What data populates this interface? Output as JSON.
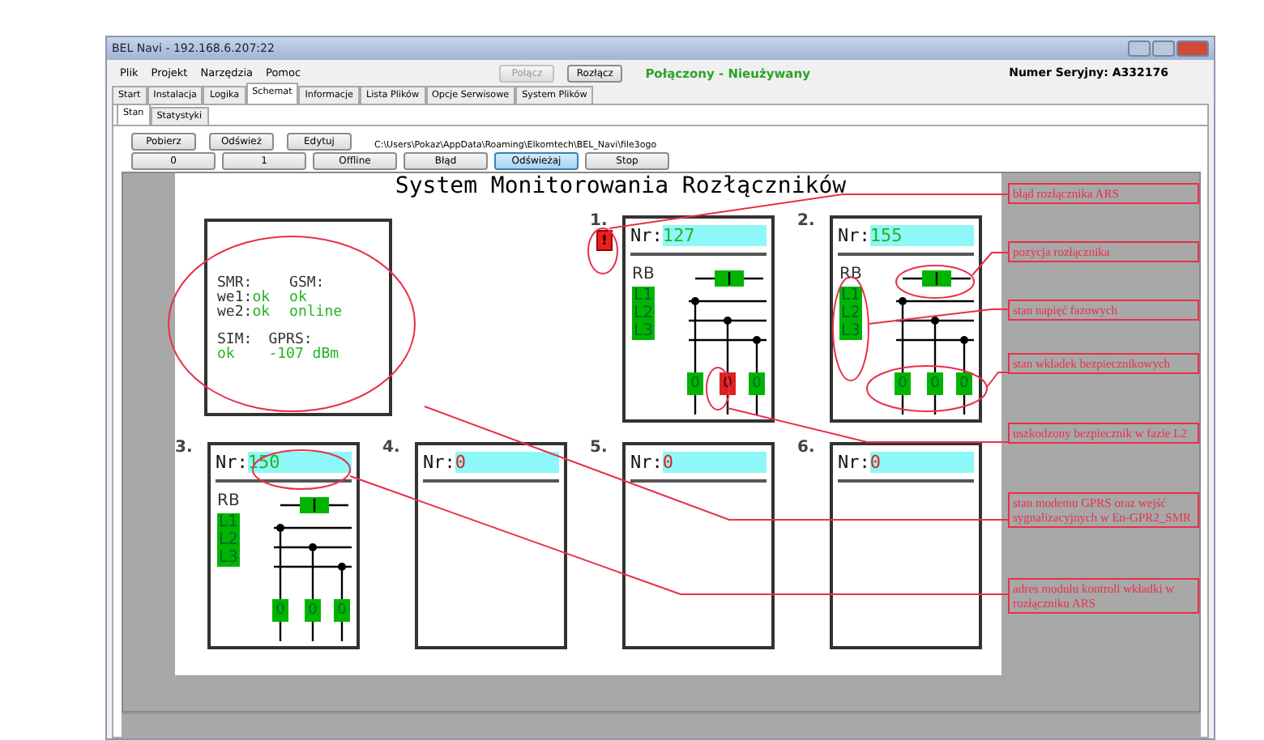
{
  "window": {
    "title": "BEL Navi - 192.168.6.207:22"
  },
  "menu": [
    "Plik",
    "Projekt",
    "Narzędzia",
    "Pomoc"
  ],
  "connection": {
    "connect_label": "Połącz",
    "connect_disabled": true,
    "disconnect_label": "Rozłącz",
    "status": "Połączony - Nieużywany",
    "serial": "Numer Seryjny: A332176"
  },
  "tabs": [
    {
      "label": "Start",
      "selected": false
    },
    {
      "label": "Instalacja",
      "selected": false
    },
    {
      "label": "Logika",
      "selected": false
    },
    {
      "label": "Schemat",
      "selected": true
    },
    {
      "label": "Informacje",
      "selected": false
    },
    {
      "label": "Lista Plików",
      "selected": false
    },
    {
      "label": "Opcje Serwisowe",
      "selected": false
    },
    {
      "label": "System Plików",
      "selected": false
    }
  ],
  "subtabs": [
    {
      "label": "Stan",
      "selected": true
    },
    {
      "label": "Statystyki",
      "selected": false
    }
  ],
  "toolbar": {
    "buttons": [
      "Pobierz",
      "Odśwież",
      "Edytuj"
    ],
    "path": "C:\\Users\\Pokaz\\AppData\\Roaming\\Elkomtech\\BEL_Navi\\file3ogo"
  },
  "mode_buttons": [
    {
      "label": "0",
      "selected": false
    },
    {
      "label": "1",
      "selected": false
    },
    {
      "label": "Offline",
      "selected": false
    },
    {
      "label": "Błąd",
      "selected": false
    },
    {
      "label": "Odświeżaj",
      "selected": true
    },
    {
      "label": "Stop",
      "selected": false
    }
  ],
  "canvas": {
    "title": "System Monitorowania Rozłączników",
    "status_panel": {
      "smr_label": "SMR:",
      "we1_label": "we1:",
      "we1_value": "ok",
      "we2_label": "we2:",
      "we2_value": "ok",
      "gsm_label": "GSM:",
      "gsm_value": "ok",
      "gsm_state": "online",
      "sim_label": "SIM:",
      "sim_value": "ok",
      "gprs_label": "GPRS:",
      "gprs_value": "-107 dBm"
    },
    "modules": [
      {
        "number": "1.",
        "nr_label": "Nr:",
        "nr_value": "127",
        "nr_valid": true,
        "error": true,
        "error_text": "!",
        "diagram": {
          "rb_label": "RB",
          "phases": [
            {
              "label": "L1",
              "on": true
            },
            {
              "label": "L2",
              "on": true
            },
            {
              "label": "L3",
              "on": true
            }
          ],
          "fuses": [
            {
              "text": "0",
              "ok": true
            },
            {
              "text": "0",
              "ok": false
            },
            {
              "text": "0",
              "ok": true
            }
          ]
        }
      },
      {
        "number": "2.",
        "nr_label": "Nr:",
        "nr_value": "155",
        "nr_valid": true,
        "error": false,
        "diagram": {
          "rb_label": "RB",
          "phases": [
            {
              "label": "L1",
              "on": true
            },
            {
              "label": "L2",
              "on": true
            },
            {
              "label": "L3",
              "on": true
            }
          ],
          "fuses": [
            {
              "text": "0",
              "ok": true
            },
            {
              "text": "0",
              "ok": true
            },
            {
              "text": "0",
              "ok": true
            }
          ]
        }
      },
      {
        "number": "3.",
        "nr_label": "Nr:",
        "nr_value": "150",
        "nr_valid": true,
        "error": false,
        "diagram": {
          "rb_label": "RB",
          "phases": [
            {
              "label": "L1",
              "on": true
            },
            {
              "label": "L2",
              "on": true
            },
            {
              "label": "L3",
              "on": true
            }
          ],
          "fuses": [
            {
              "text": "0",
              "ok": true
            },
            {
              "text": "0",
              "ok": true
            },
            {
              "text": "0",
              "ok": true
            }
          ]
        }
      },
      {
        "number": "4.",
        "nr_label": "Nr:",
        "nr_value": "0",
        "nr_valid": false,
        "error": false
      },
      {
        "number": "5.",
        "nr_label": "Nr:",
        "nr_value": "0",
        "nr_valid": false,
        "error": false
      },
      {
        "number": "6.",
        "nr_label": "Nr:",
        "nr_value": "0",
        "nr_valid": false,
        "error": false
      }
    ]
  },
  "annotations": [
    {
      "text": "błąd rozłącznika ARS"
    },
    {
      "text": "pozycja rozłącznika"
    },
    {
      "text": "stan napięć fazowych"
    },
    {
      "text": "stan wkładek bezpiecznikowych"
    },
    {
      "text": "uszkodzony bezpiecznik w fazie L2"
    },
    {
      "text": "stan modemu GPRS oraz wejść sygnalizacyjnych w En-GPR2_SMR"
    },
    {
      "text": "adres modułu kontroli wkładki w rozłączniku ARS"
    }
  ]
}
